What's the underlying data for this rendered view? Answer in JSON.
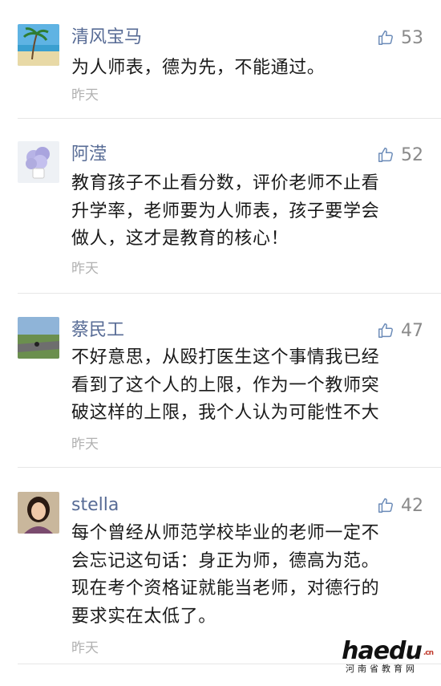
{
  "comments": [
    {
      "name": "清风宝马",
      "likes": "53",
      "lines": [
        "为人师表，德为先，不能通过。"
      ],
      "time": "昨天",
      "avatar_icon": "beach-scene"
    },
    {
      "name": "阿滢",
      "likes": "52",
      "lines": [
        "教育孩子不止看分数，评价老师不止看",
        "升学率，老师要为人师表，孩子要学会",
        "做人，这才是教育的核心！"
      ],
      "time": "昨天",
      "avatar_icon": "flower-vase"
    },
    {
      "name": "蔡民工",
      "likes": "47",
      "lines": [
        "不好意思，从殴打医生这个事情我已经",
        "看到了这个人的上限，作为一个教师突",
        "破这样的上限，我个人认为可能性不大"
      ],
      "time": "昨天",
      "avatar_icon": "road-landscape"
    },
    {
      "name": "stella",
      "likes": "42",
      "lines": [
        "每个曾经从师范学校毕业的老师一定不",
        "会忘记这句话：身正为师，德高为范。",
        "现在考个资格证就能当老师，对德行的",
        "要求实在太低了。"
      ],
      "time": "昨天",
      "avatar_icon": "woman-portrait"
    }
  ],
  "watermark": {
    "logo": "haedu",
    "logo_sup": ".cn",
    "subtitle": "河南省教育网"
  },
  "colors": {
    "name": "#576b95",
    "text": "#1a1a1a",
    "time": "#b2b2b2",
    "likes": "#8a8a8a"
  }
}
